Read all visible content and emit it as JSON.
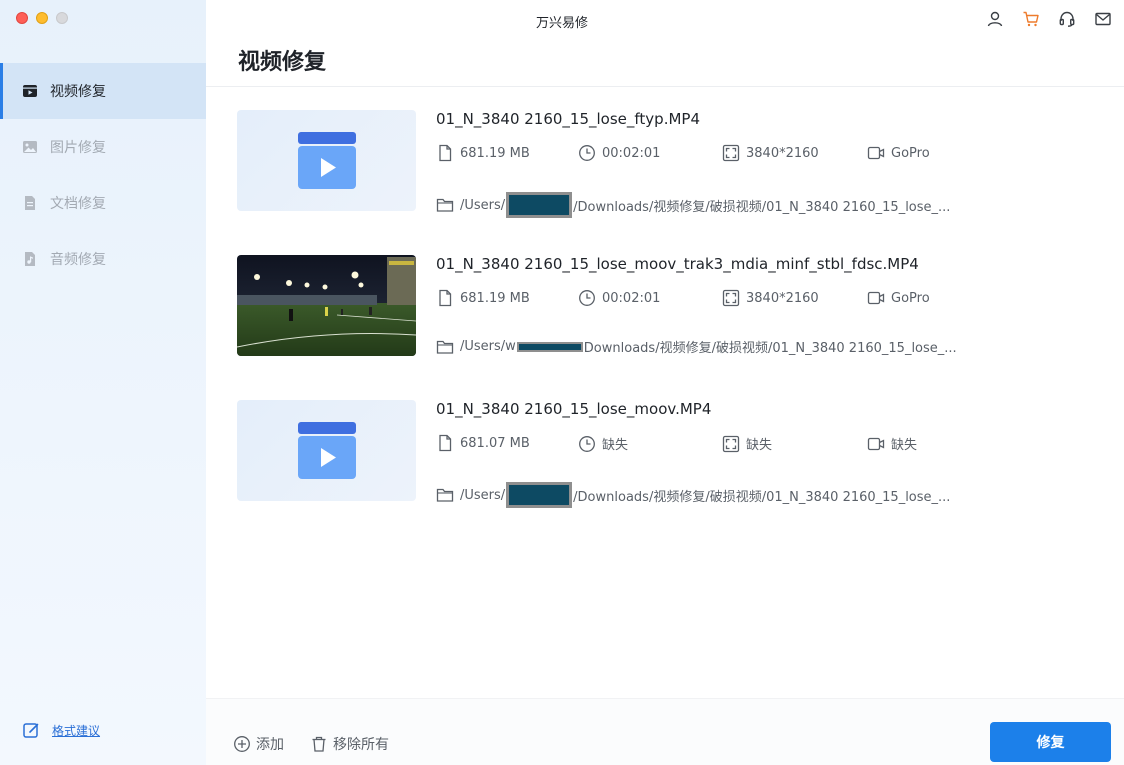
{
  "app": {
    "title": "万兴易修"
  },
  "page": {
    "title": "视频修复"
  },
  "sidebar": {
    "items": [
      {
        "label": "视频修复",
        "icon": "video-icon",
        "active": true
      },
      {
        "label": "图片修复",
        "icon": "image-icon",
        "active": false
      },
      {
        "label": "文档修复",
        "icon": "document-icon",
        "active": false
      },
      {
        "label": "音频修复",
        "icon": "audio-icon",
        "active": false
      }
    ],
    "feedback_label": "格式建议"
  },
  "files": [
    {
      "name": "01_N_3840 2160_15_lose_ftyp.MP4",
      "thumbnail": "video-placeholder",
      "size": "681.19 MB",
      "duration": "00:02:01",
      "resolution": "3840*2160",
      "camera": "GoPro",
      "path_prefix": "/Users/",
      "path_suffix": "/Downloads/视频修复/破损视频/01_N_3840 2160_15_lose_..."
    },
    {
      "name": "01_N_3840 2160_15_lose_moov_trak3_mdia_minf_stbl_fdsc.MP4",
      "thumbnail": "video-frame",
      "size": "681.19 MB",
      "duration": "00:02:01",
      "resolution": "3840*2160",
      "camera": "GoPro",
      "path_prefix": "/Users/w",
      "path_suffix": "Downloads/视频修复/破损视频/01_N_3840 2160_15_lose_..."
    },
    {
      "name": "01_N_3840 2160_15_lose_moov.MP4",
      "thumbnail": "video-placeholder",
      "size": "681.07 MB",
      "duration": "缺失",
      "resolution": "缺失",
      "camera": "缺失",
      "path_prefix": "/Users/",
      "path_suffix": "/Downloads/视频修复/破损视频/01_N_3840 2160_15_lose_..."
    }
  ],
  "footer": {
    "add_label": "添加",
    "clear_label": "移除所有",
    "repair_label": "修复"
  },
  "colors": {
    "accent": "#1c80ea",
    "cart": "#ee7b2c",
    "redaction": "#0d4a63"
  }
}
